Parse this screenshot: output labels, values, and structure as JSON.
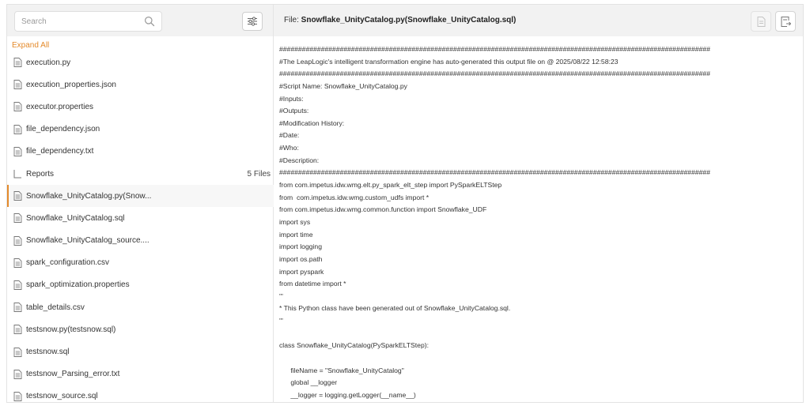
{
  "search": {
    "placeholder": "Search"
  },
  "expand_all": "Expand All",
  "tree": [
    {
      "label": "execution.py",
      "type": "file"
    },
    {
      "label": "execution_properties.json",
      "type": "file"
    },
    {
      "label": "executor.properties",
      "type": "file"
    },
    {
      "label": "file_dependency.json",
      "type": "file"
    },
    {
      "label": "file_dependency.txt",
      "type": "file"
    },
    {
      "label": "Reports",
      "type": "folder",
      "count": "5 Files"
    },
    {
      "label": "Snowflake_UnityCatalog.py(Snow...",
      "type": "file",
      "active": true
    },
    {
      "label": "Snowflake_UnityCatalog.sql",
      "type": "file"
    },
    {
      "label": "Snowflake_UnityCatalog_source....",
      "type": "file"
    },
    {
      "label": "spark_configuration.csv",
      "type": "file"
    },
    {
      "label": "spark_optimization.properties",
      "type": "file"
    },
    {
      "label": "table_details.csv",
      "type": "file"
    },
    {
      "label": "testsnow.py(testsnow.sql)",
      "type": "file"
    },
    {
      "label": "testsnow.sql",
      "type": "file"
    },
    {
      "label": "testsnow_Parsing_error.txt",
      "type": "file"
    },
    {
      "label": "testsnow_source.sql",
      "type": "file"
    }
  ],
  "header": {
    "file_prefix": "File: ",
    "file_name": "Snowflake_UnityCatalog.py(Snowflake_UnityCatalog.sql)"
  },
  "code_lines": [
    "##################################################################################################################",
    "#The LeapLogic's intelligent transformation engine has auto-generated this output file on @ 2025/08/22 12:58:23",
    "##################################################################################################################",
    "#Script Name: Snowflake_UnityCatalog.py",
    "#Inputs:",
    "#Outputs:",
    "#Modification History:",
    "#Date:",
    "#Who:",
    "#Description:",
    "##################################################################################################################",
    "from com.impetus.idw.wmg.elt.py_spark_elt_step import PySparkELTStep",
    "from  com.impetus.idw.wmg.custom_udfs import *",
    "from com.impetus.idw.wmg.common.function import Snowflake_UDF",
    "import sys",
    "import time",
    "import logging",
    "import os.path",
    "import pyspark",
    "from datetime import *",
    "'''",
    "* This Python class have been generated out of Snowflake_UnityCatalog.sql.",
    "'''",
    "",
    "class Snowflake_UnityCatalog(PySparkELTStep):",
    "",
    "      fileName = \"Snowflake_UnityCatalog\"",
    "      global __logger",
    "      __logger = logging.getLogger(__name__)"
  ]
}
